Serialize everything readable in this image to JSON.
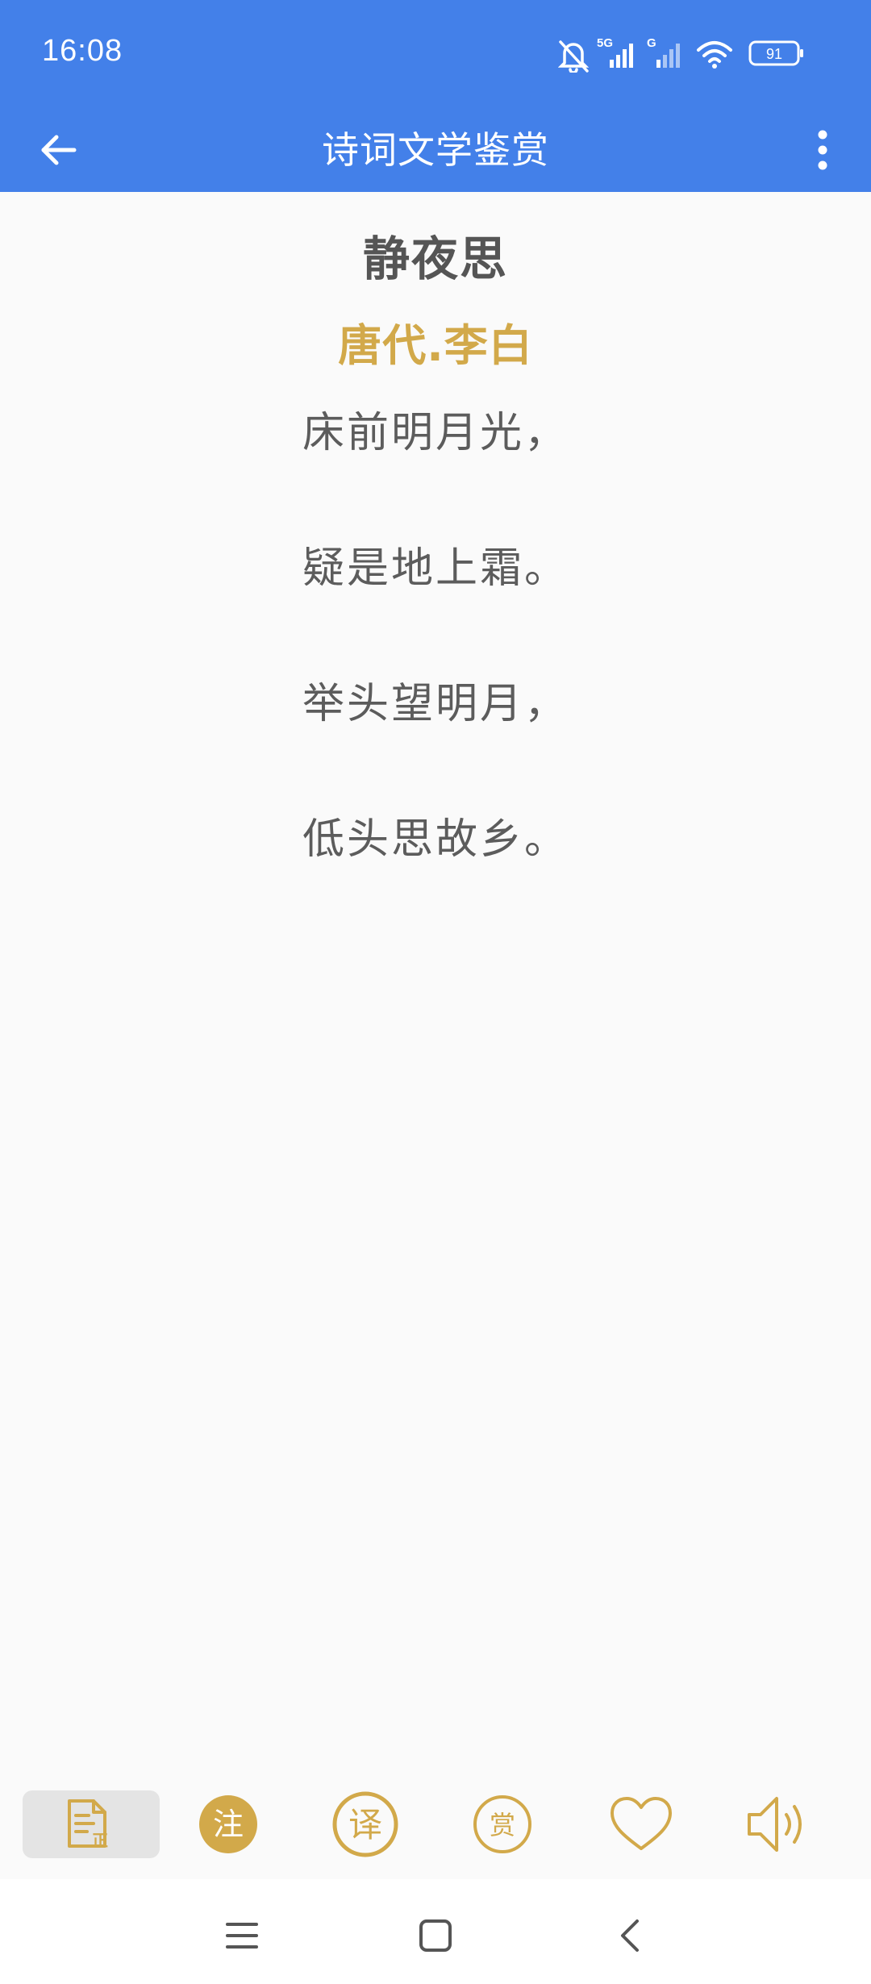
{
  "status_bar": {
    "time": "16:08",
    "network_1": "5G",
    "network_2": "G",
    "battery": "91",
    "icons": [
      "bell-muted-icon",
      "signal-5g-icon",
      "signal-g-icon",
      "wifi-icon",
      "battery-icon"
    ]
  },
  "app_bar": {
    "title": "诗词文学鉴赏",
    "back_icon": "arrow-left-icon",
    "more_icon": "more-vertical-icon"
  },
  "poem": {
    "title": "静夜思",
    "author": "唐代.李白",
    "lines": [
      "床前明月光，",
      "疑是地上霜。",
      "举头望明月，",
      "低头思故乡。"
    ]
  },
  "toolbar": {
    "accent": "#d2a94a",
    "buttons": [
      {
        "name": "original-text",
        "label": "正",
        "icon": "document-original-icon",
        "active": true
      },
      {
        "name": "annotation",
        "label": "注",
        "icon": "annotation-circle-icon",
        "active": false
      },
      {
        "name": "translation",
        "label": "译",
        "icon": "translation-circle-icon",
        "active": false
      },
      {
        "name": "appreciation",
        "label": "赏",
        "icon": "appreciation-circle-icon",
        "active": false
      },
      {
        "name": "favorite",
        "label": "",
        "icon": "heart-icon",
        "active": false
      },
      {
        "name": "read-aloud",
        "label": "",
        "icon": "speaker-icon",
        "active": false
      }
    ]
  },
  "nav_bar": {
    "icons": [
      "menu-icon",
      "home-square-icon",
      "back-chevron-icon"
    ]
  },
  "colors": {
    "primary": "#4380e9",
    "accent": "#d2a94a",
    "text": "#5c5c5c",
    "background": "#fafafa"
  }
}
